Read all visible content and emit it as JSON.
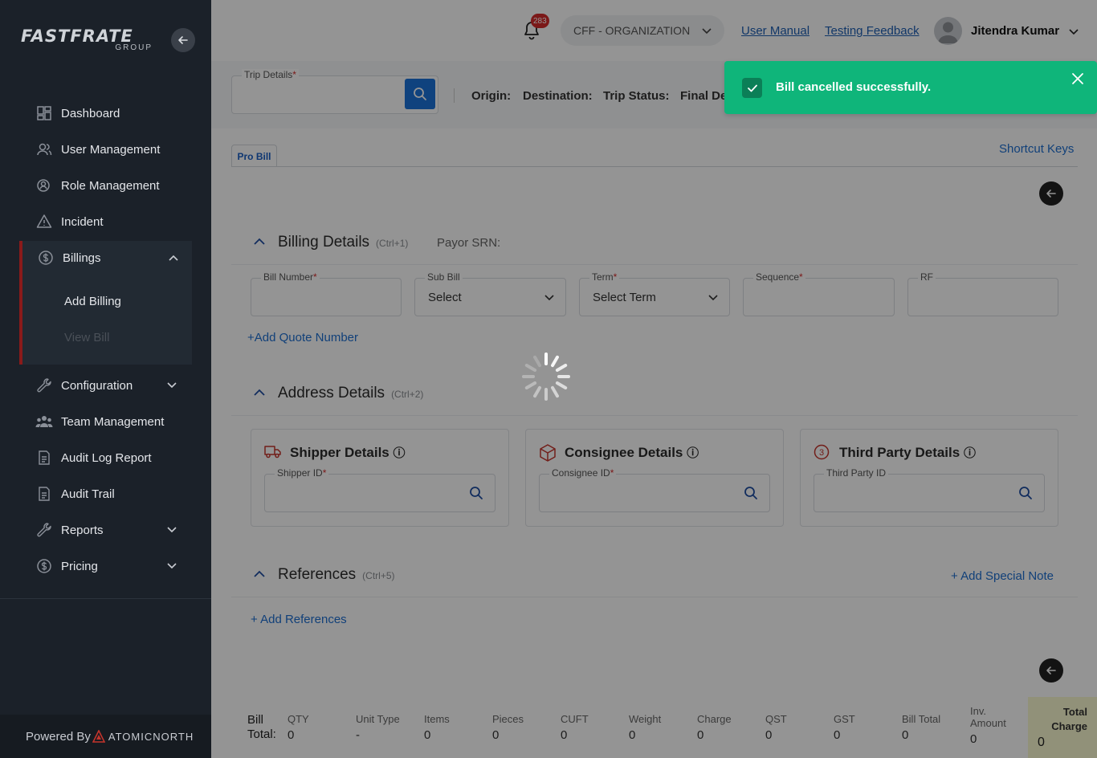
{
  "sidebar": {
    "logo_main": "FASTFRATE",
    "logo_sub": "GROUP",
    "items": [
      {
        "label": "Dashboard",
        "icon": "dashboard-icon"
      },
      {
        "label": "User Management",
        "icon": "users-icon"
      },
      {
        "label": "Role Management",
        "icon": "role-icon"
      },
      {
        "label": "Incident",
        "icon": "warning-icon"
      },
      {
        "label": "Billings",
        "icon": "dollar-icon"
      },
      {
        "label": "Configuration",
        "icon": "wrench-icon"
      },
      {
        "label": "Team Management",
        "icon": "team-icon"
      },
      {
        "label": "Audit Log Report",
        "icon": "report-icon"
      },
      {
        "label": "Audit Trail",
        "icon": "report-icon"
      },
      {
        "label": "Reports",
        "icon": "wrench-icon"
      },
      {
        "label": "Pricing",
        "icon": "dollar-icon"
      }
    ],
    "billings_sub": [
      "Add Billing",
      "View Bill"
    ],
    "powered_by": "Powered By",
    "powered_brand": "ATOMICNORTH"
  },
  "header": {
    "notification_count": "283",
    "org_select": "CFF - ORGANIZATION",
    "links": [
      "User Manual",
      "Testing Feedback"
    ],
    "user_name": "Jitendra Kumar"
  },
  "trip": {
    "label": "Trip Details",
    "info": [
      "Origin:",
      "Destination:",
      "Trip Status:",
      "Final De"
    ]
  },
  "tabs": {
    "active": "Pro Bill",
    "shortcut_keys": "Shortcut Keys"
  },
  "billing": {
    "title": "Billing Details",
    "shortcut": "(Ctrl+1)",
    "payor": "Payor SRN:",
    "fields": {
      "bill_number": "Bill Number",
      "sub_bill": "Sub Bill",
      "sub_bill_value": "Select",
      "term": "Term",
      "term_value": "Select Term",
      "sequence": "Sequence",
      "rf": "RF"
    },
    "add_quote": "+Add Quote Number"
  },
  "address": {
    "title": "Address Details",
    "shortcut": "(Ctrl+2)",
    "cards": [
      {
        "title": "Shipper Details",
        "field": "Shipper ID"
      },
      {
        "title": "Consignee Details",
        "field": "Consignee ID"
      },
      {
        "title": "Third Party Details",
        "field": "Third Party ID"
      }
    ]
  },
  "references": {
    "title": "References",
    "shortcut": "(Ctrl+5)",
    "add_special_note": "Add Special Note",
    "add_references": "Add References"
  },
  "totals": {
    "label_line1": "Bill",
    "label_line2": "Total:",
    "columns": [
      {
        "h": "QTY",
        "v": "0"
      },
      {
        "h": "Unit Type",
        "v": "-"
      },
      {
        "h": "Items",
        "v": "0"
      },
      {
        "h": "Pieces",
        "v": "0"
      },
      {
        "h": "CUFT",
        "v": "0"
      },
      {
        "h": "Weight",
        "v": "0"
      },
      {
        "h": "Charge",
        "v": "0"
      },
      {
        "h": "QST",
        "v": "0"
      },
      {
        "h": "GST",
        "v": "0"
      },
      {
        "h": "Bill Total",
        "v": "0"
      }
    ],
    "inv_amount_line1": "Inv.",
    "inv_amount_line2": "Amount",
    "inv_amount_value": "0",
    "total_charge_line1": "Total",
    "total_charge_line2": "Charge",
    "total_charge_value": "0"
  },
  "toast": {
    "message": "Bill cancelled successfully."
  }
}
